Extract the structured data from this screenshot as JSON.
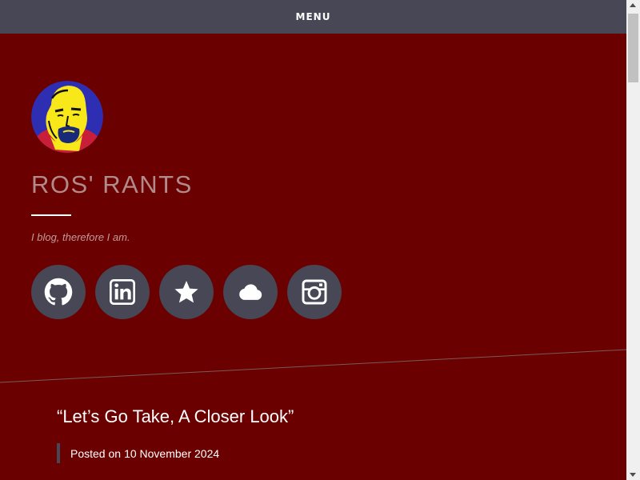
{
  "header": {
    "menu_label": "MENU"
  },
  "site": {
    "title": "ROS' RANTS",
    "tagline": "I blog, therefore I am.",
    "avatar_icon": "face-portrait-icon"
  },
  "social_links": [
    {
      "name": "github",
      "icon": "github-icon"
    },
    {
      "name": "linkedin",
      "icon": "linkedin-icon"
    },
    {
      "name": "star",
      "icon": "star-icon"
    },
    {
      "name": "cloud",
      "icon": "cloud-icon"
    },
    {
      "name": "instagram",
      "icon": "instagram-icon"
    }
  ],
  "post": {
    "title": "“Let’s Go Take, A Closer Look”",
    "posted_on_label": "Posted on",
    "date": "10 November 2024"
  },
  "colors": {
    "background": "#6a0000",
    "menu_bar": "#474755",
    "social_button": "#474755",
    "site_title": "#b28a8a",
    "tagline": "#c49a9a",
    "text": "#ffffff"
  }
}
